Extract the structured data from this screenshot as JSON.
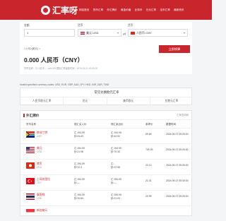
{
  "header": {
    "logo_text": "汇率呀",
    "nav": [
      "网站首页",
      "货币汇率",
      "外汇牌价",
      "黄金价格",
      "比特币",
      "日元汇率",
      "法币汇率",
      "最新资讯"
    ]
  },
  "converter": {
    "amount_label": "金额",
    "amount_value": "1",
    "from_label": "货币",
    "from_value": "美元 USD",
    "to_label": "货币",
    "to_value": "人民币 CNY",
    "swap_glyph": "⇄",
    "small_rate": "1 USD(美元) =",
    "result": "0.000 人民币（CNY）",
    "info": "货币名称：与人民币 ↔ unit.000  国际汇率最新时间：1970-01-01 00:00:00",
    "button": "立即换算"
  },
  "invalid_text": "Invalid specified currency codes: USD, EUR, GBP, AUD, JPY, HKD, INR, ZAR, TWD",
  "hot": {
    "title": "常见兑换欧元汇率",
    "items": [
      "人民币欧元汇率",
      "兑元",
      "澳币欧元",
      "兑港元汇率"
    ]
  },
  "rates": {
    "title": "外汇牌价",
    "stamp": "汇率查询网",
    "headers": [
      "货币名称",
      "现汇买入价",
      "现汇卖出价",
      "参考价",
      "数据时间"
    ],
    "rows": [
      {
        "name": "南非兰特",
        "code": "ZAR",
        "buy": "汇:194.09",
        "buy2": "钞:41.43",
        "sell": "汇:194.09",
        "sell2": "钞:42.02",
        "ref": "69.69",
        "time": "2024-09-07 05:30:00"
      },
      {
        "name": "美元",
        "code": "USD",
        "buy": "汇:194.09",
        "buy2": "钞:21.98",
        "sell": "汇:194.09",
        "sell2": "钞:70.33",
        "ref": "709.25",
        "time": "2024-09-07 05:30:00"
      },
      {
        "name": "港币",
        "code": "HKD",
        "buy": "汇:194.09",
        "buy2": "钞:22.3",
        "sell": "汇:-",
        "sell2": "钞:22.98",
        "ref": "22.13",
        "time": "2024-09-07 05:30:00"
      },
      {
        "name": "土耳其里拉",
        "code": "TRY",
        "buy": "汇:194.09",
        "buy2": "钞:—",
        "sell": "汇:194.09",
        "sell2": "钞:—",
        "ref": "21.01",
        "time": "2024-09-07 05:30:00"
      },
      {
        "name": "泰国铢",
        "code": "THB",
        "buy": "汇:194.09",
        "buy2": "钞:20.84",
        "sell": "汇:194.09",
        "sell2": "钞:21.03",
        "ref": "20.99",
        "time": "2024-09-07 05:30:00"
      },
      {
        "name": "新加坡元",
        "code": "SGD",
        "buy": "",
        "buy2": "",
        "sell": "",
        "sell2": "",
        "ref": "",
        "time": ""
      }
    ]
  },
  "colors": {
    "brand": "#c9252c"
  }
}
